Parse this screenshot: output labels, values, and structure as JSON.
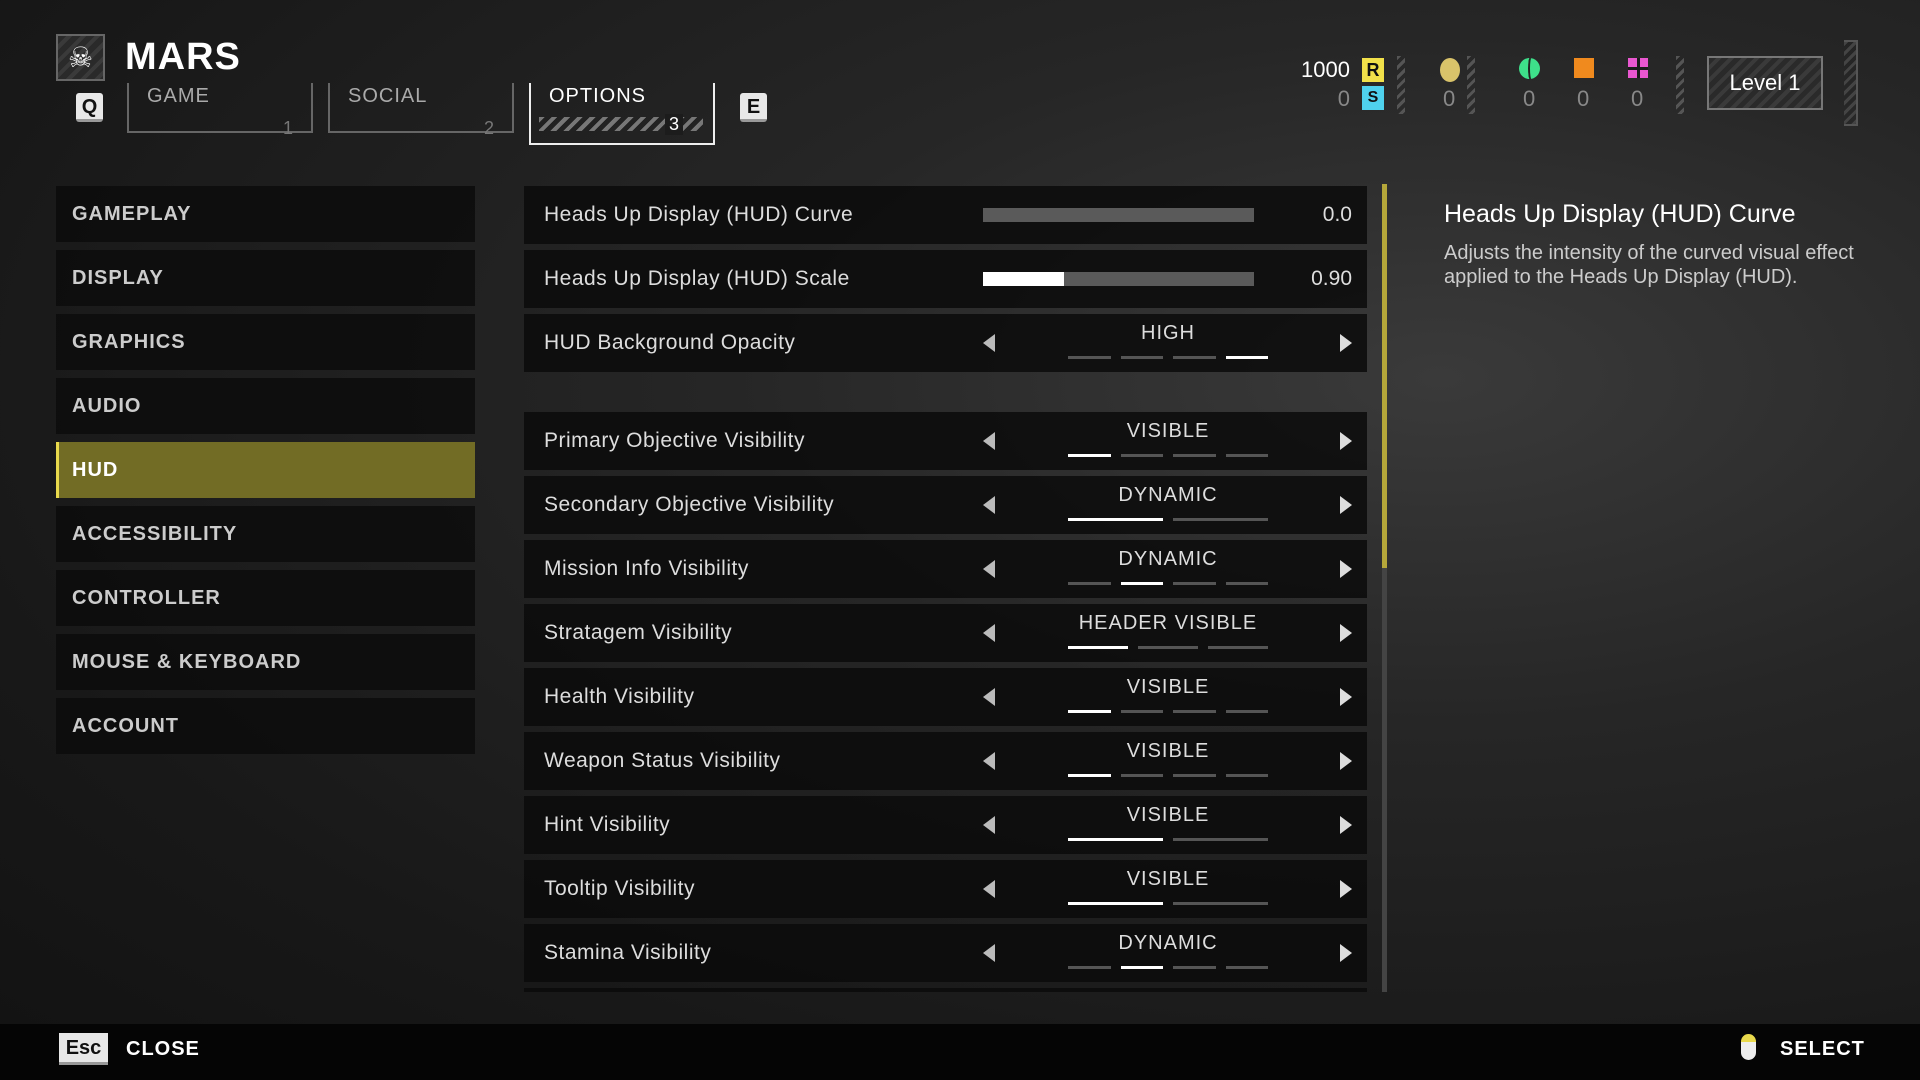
{
  "header": {
    "title": "MARS",
    "logo_icon": "skull-icon",
    "prev_key": "Q",
    "next_key": "E",
    "tabs": [
      {
        "label": "GAME",
        "number": "1"
      },
      {
        "label": "SOCIAL",
        "number": "2"
      },
      {
        "label": "OPTIONS",
        "number": "3",
        "active": true
      }
    ]
  },
  "currencies": {
    "requisition": "1000",
    "super_credits": "0",
    "medals": "0",
    "green": "0",
    "orange": "0",
    "pink": "0"
  },
  "colors": {
    "accent": "#e9d94c",
    "requisition": "#f2e14a",
    "super_credits": "#4fd2ee",
    "green": "#3ee08a",
    "orange": "#f08a1e",
    "pink": "#e957d0"
  },
  "level": "Level 1",
  "sidebar": {
    "items": [
      {
        "label": "GAMEPLAY"
      },
      {
        "label": "DISPLAY"
      },
      {
        "label": "GRAPHICS"
      },
      {
        "label": "AUDIO"
      },
      {
        "label": "HUD",
        "active": true
      },
      {
        "label": "ACCESSIBILITY"
      },
      {
        "label": "CONTROLLER"
      },
      {
        "label": "MOUSE & KEYBOARD"
      },
      {
        "label": "ACCOUNT"
      }
    ]
  },
  "settings": [
    {
      "label": "Heads Up Display (HUD) Curve",
      "type": "slider",
      "value": "0.0",
      "fill": 0
    },
    {
      "label": "Heads Up Display (HUD) Scale",
      "type": "slider",
      "value": "0.90",
      "fill": 0.3
    },
    {
      "label": "HUD Background Opacity",
      "type": "select",
      "value": "HIGH",
      "options": 4,
      "selected": 3
    },
    {
      "label": "Primary Objective Visibility",
      "type": "select",
      "value": "VISIBLE",
      "options": 4,
      "selected": 0
    },
    {
      "label": "Secondary Objective Visibility",
      "type": "select",
      "value": "DYNAMIC",
      "options": 2,
      "selected": 0
    },
    {
      "label": "Mission Info Visibility",
      "type": "select",
      "value": "DYNAMIC",
      "options": 4,
      "selected": 1
    },
    {
      "label": "Stratagem Visibility",
      "type": "select",
      "value": "HEADER VISIBLE",
      "options": 3,
      "selected": 0
    },
    {
      "label": "Health Visibility",
      "type": "select",
      "value": "VISIBLE",
      "options": 4,
      "selected": 0
    },
    {
      "label": "Weapon Status Visibility",
      "type": "select",
      "value": "VISIBLE",
      "options": 4,
      "selected": 0
    },
    {
      "label": "Hint Visibility",
      "type": "select",
      "value": "VISIBLE",
      "options": 2,
      "selected": 0
    },
    {
      "label": "Tooltip Visibility",
      "type": "select",
      "value": "VISIBLE",
      "options": 2,
      "selected": 0
    },
    {
      "label": "Stamina Visibility",
      "type": "select",
      "value": "DYNAMIC",
      "options": 4,
      "selected": 1
    }
  ],
  "description": {
    "title": "Heads Up Display (HUD) Curve",
    "body": "Adjusts the intensity of the curved visual effect applied to the Heads Up Display (HUD)."
  },
  "footer": {
    "close_key": "Esc",
    "close_label": "CLOSE",
    "select_label": "SELECT",
    "select_icon": "mouse-icon"
  }
}
